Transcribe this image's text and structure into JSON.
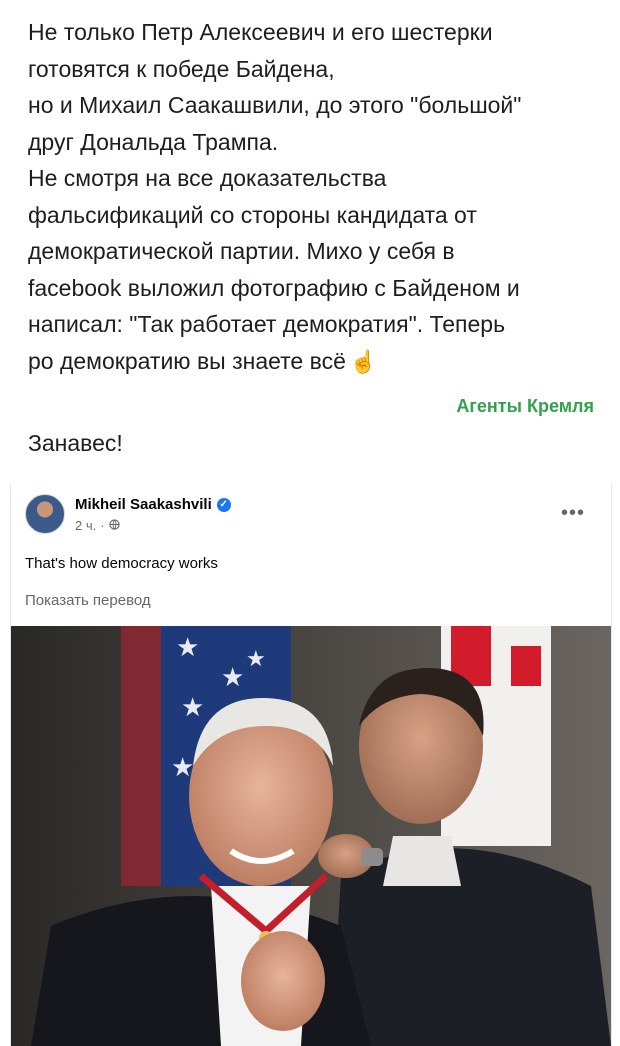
{
  "post": {
    "lines": [
      "Не только Петр Алексеевич и его шестерки",
      "готовятся к победе Байдена,",
      "но и Михаил Саакашвили, до этого \"большой\"",
      "друг Дональда Трампа.",
      "Не смотря на все доказательства",
      "фальсификаций со стороны кандидата от",
      "демократической партии. Михо у себя в",
      "facebook выложил фотографию с Байденом и",
      "написал: \"Так работает демократия\". Теперь",
      "ро демократию вы знаете всё"
    ],
    "emoji": "☝",
    "author_tag": "Агенты Кремля",
    "closing": "Занавес!"
  },
  "embed": {
    "author_name": "Mikheil Saakashvili",
    "time": "2 ч.",
    "separator": "·",
    "audience_icon": "globe-icon",
    "more_icon": "•••",
    "caption": "That's how democracy works",
    "translate_link": "Показать перевод",
    "verified_color": "#1877f2"
  },
  "colors": {
    "author_tag": "#31a24c",
    "text": "#1c1e21",
    "secondary": "#65676b"
  }
}
